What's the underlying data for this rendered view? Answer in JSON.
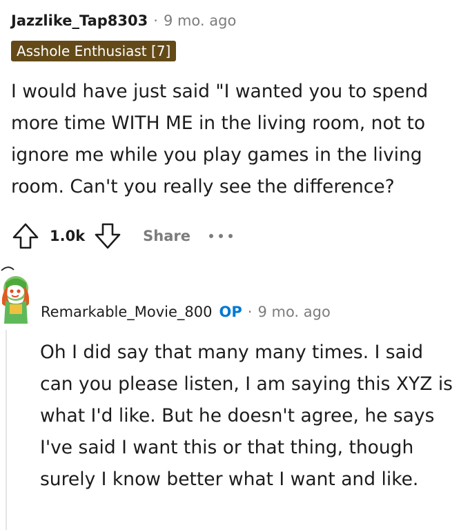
{
  "comment1": {
    "author": "Jazzlike_Tap8303",
    "separator": "·",
    "time": "9 mo. ago",
    "flair": "Asshole Enthusiast [7]",
    "body": "I would have just said \"I wanted you to spend more time WITH ME in the living room, not to ignore me while you play games in the living room. Can't you really see the difference?",
    "score": "1.0k",
    "share_label": "Share",
    "icons": [
      "upvote-icon",
      "downvote-icon",
      "more-options-icon"
    ]
  },
  "comment2": {
    "author": "Remarkable_Movie_800",
    "op_badge": "OP",
    "separator": "·",
    "time": "9 mo. ago",
    "body": "Oh I did say that many many times. I said can you please listen, I am saying this XYZ is what I'd like. But he doesn't agree, he says I've said I want this or that thing, though surely I know better what I want and like.",
    "avatar": "snoo-avatar"
  },
  "colors": {
    "flair_bg": "#634a18",
    "op_blue": "#0079d3",
    "muted": "#7c7c7c",
    "thread_line": "#e4e4e4"
  }
}
